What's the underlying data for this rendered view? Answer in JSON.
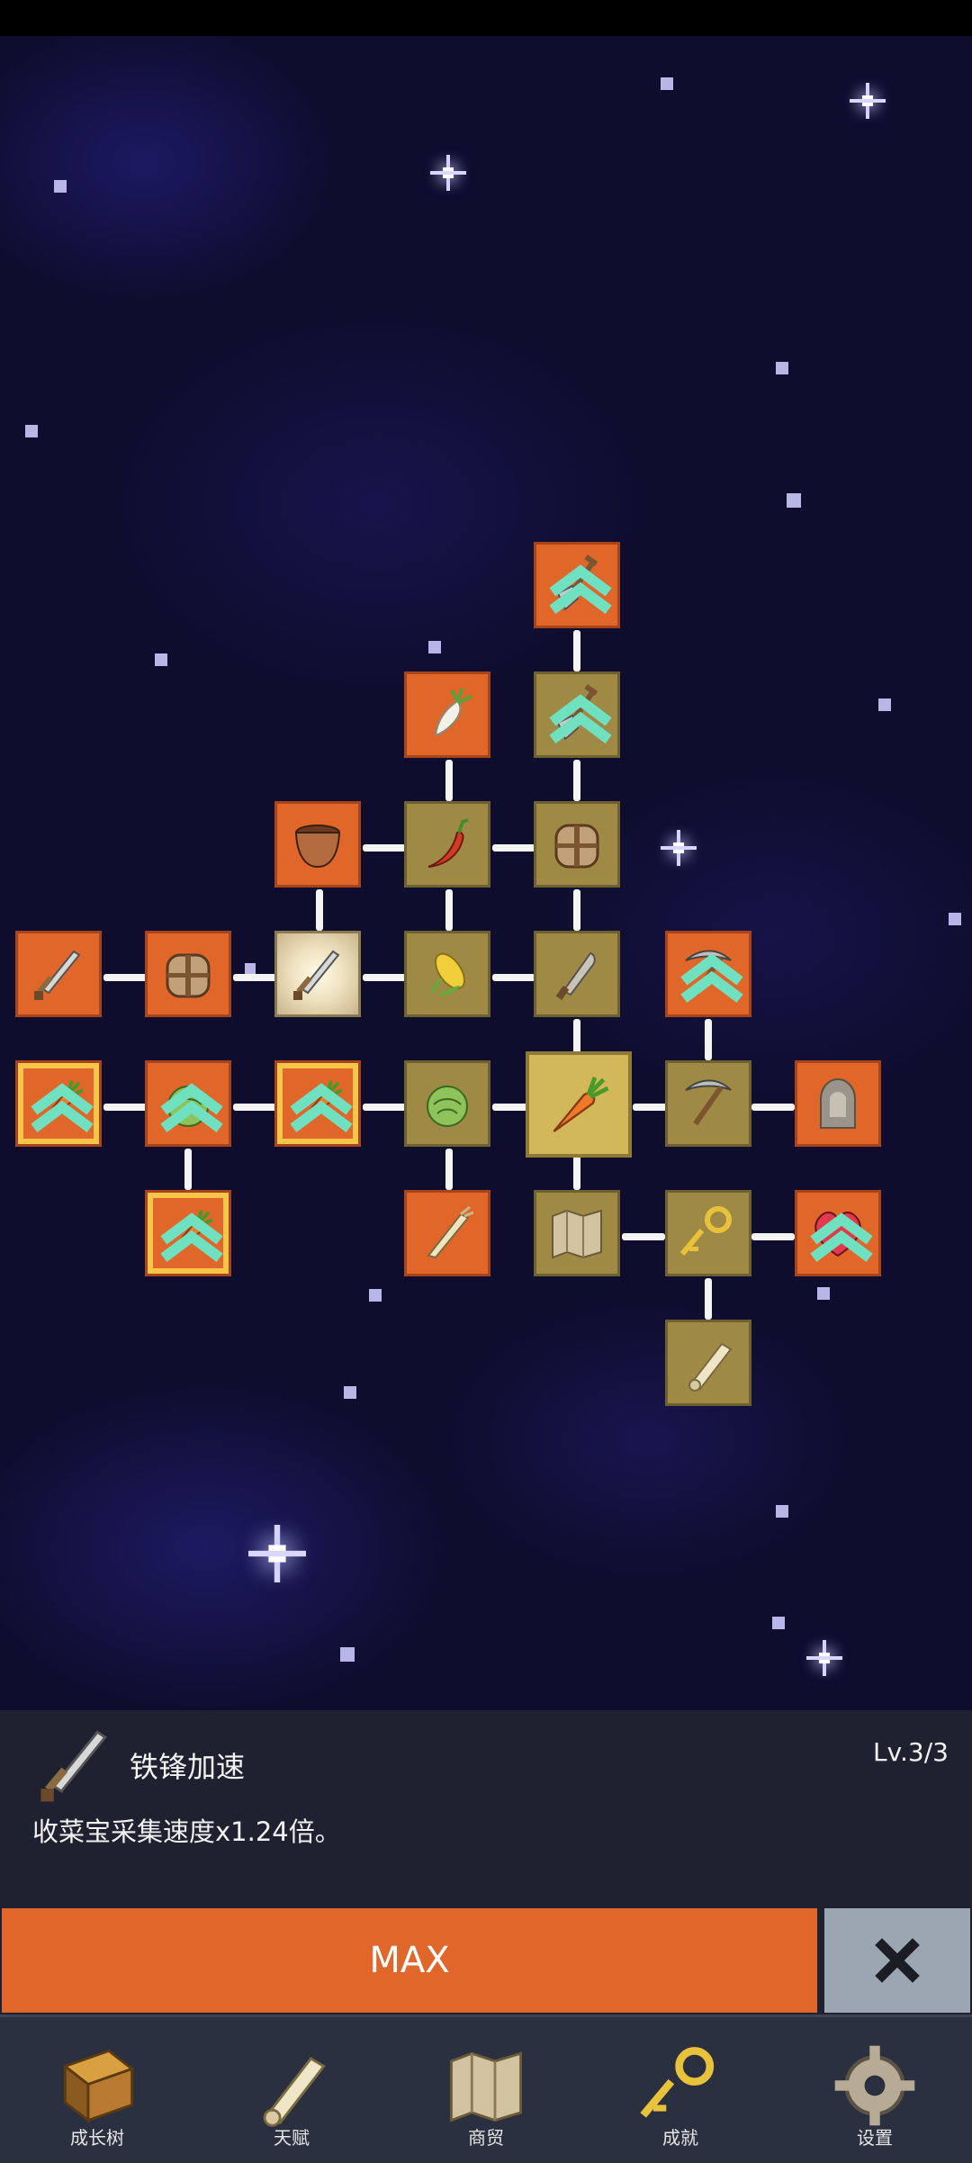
{
  "selected_skill": {
    "name": "铁锋加速",
    "level": "Lv.3/3",
    "description": "收菜宝采集速度x1.24倍。",
    "icon": "iron-sword-icon"
  },
  "actions": {
    "max_label": "MAX",
    "close_icon": "close-icon"
  },
  "nav": {
    "tabs": [
      {
        "label": "成长树",
        "icon": "book-icon"
      },
      {
        "label": "天赋",
        "icon": "scroll-icon"
      },
      {
        "label": "商贸",
        "icon": "map-icon"
      },
      {
        "label": "成就",
        "icon": "key-icon"
      },
      {
        "label": "设置",
        "icon": "gear-icon"
      }
    ]
  },
  "skill_tree": {
    "nodes": [
      {
        "icon": "shovel-icon",
        "state": "orange",
        "upgrade": true
      },
      {
        "icon": "radish-icon",
        "state": "orange"
      },
      {
        "icon": "shovel-icon",
        "state": "gold",
        "upgrade": true
      },
      {
        "icon": "pot-icon",
        "state": "orange"
      },
      {
        "icon": "chili-icon",
        "state": "gold"
      },
      {
        "icon": "backpack-icon",
        "state": "gold"
      },
      {
        "icon": "sword-icon",
        "state": "orange"
      },
      {
        "icon": "backpack-icon",
        "state": "orange"
      },
      {
        "icon": "iron-sword-icon",
        "state": "lit"
      },
      {
        "icon": "corn-icon",
        "state": "gold"
      },
      {
        "icon": "knife-icon",
        "state": "gold"
      },
      {
        "icon": "pickaxe-icon",
        "state": "orange",
        "upgrade": true
      },
      {
        "icon": "carrot-icon",
        "state": "orange-glow",
        "upgrade": true
      },
      {
        "icon": "cabbage-icon",
        "state": "orange",
        "upgrade": true
      },
      {
        "icon": "carrot-icon",
        "state": "orange-glow",
        "upgrade": true
      },
      {
        "icon": "cabbage-icon",
        "state": "gold"
      },
      {
        "icon": "carrot-icon",
        "state": "selected"
      },
      {
        "icon": "pickaxe-icon",
        "state": "gold"
      },
      {
        "icon": "ghost-icon",
        "state": "orange"
      },
      {
        "icon": "carrot-icon",
        "state": "orange",
        "upgrade": true
      },
      {
        "icon": "root-icon",
        "state": "orange"
      },
      {
        "icon": "map-icon",
        "state": "gold"
      },
      {
        "icon": "key-icon",
        "state": "gold"
      },
      {
        "icon": "heart-icon",
        "state": "orange",
        "upgrade": true
      },
      {
        "icon": "scroll-icon",
        "state": "gold"
      }
    ]
  },
  "colors": {
    "accent_orange": "#e0662a",
    "node_gold": "#9f8a45",
    "panel_bg": "#1f2130",
    "nav_bg": "#2a3040",
    "close_bg": "#9ba6b0"
  }
}
